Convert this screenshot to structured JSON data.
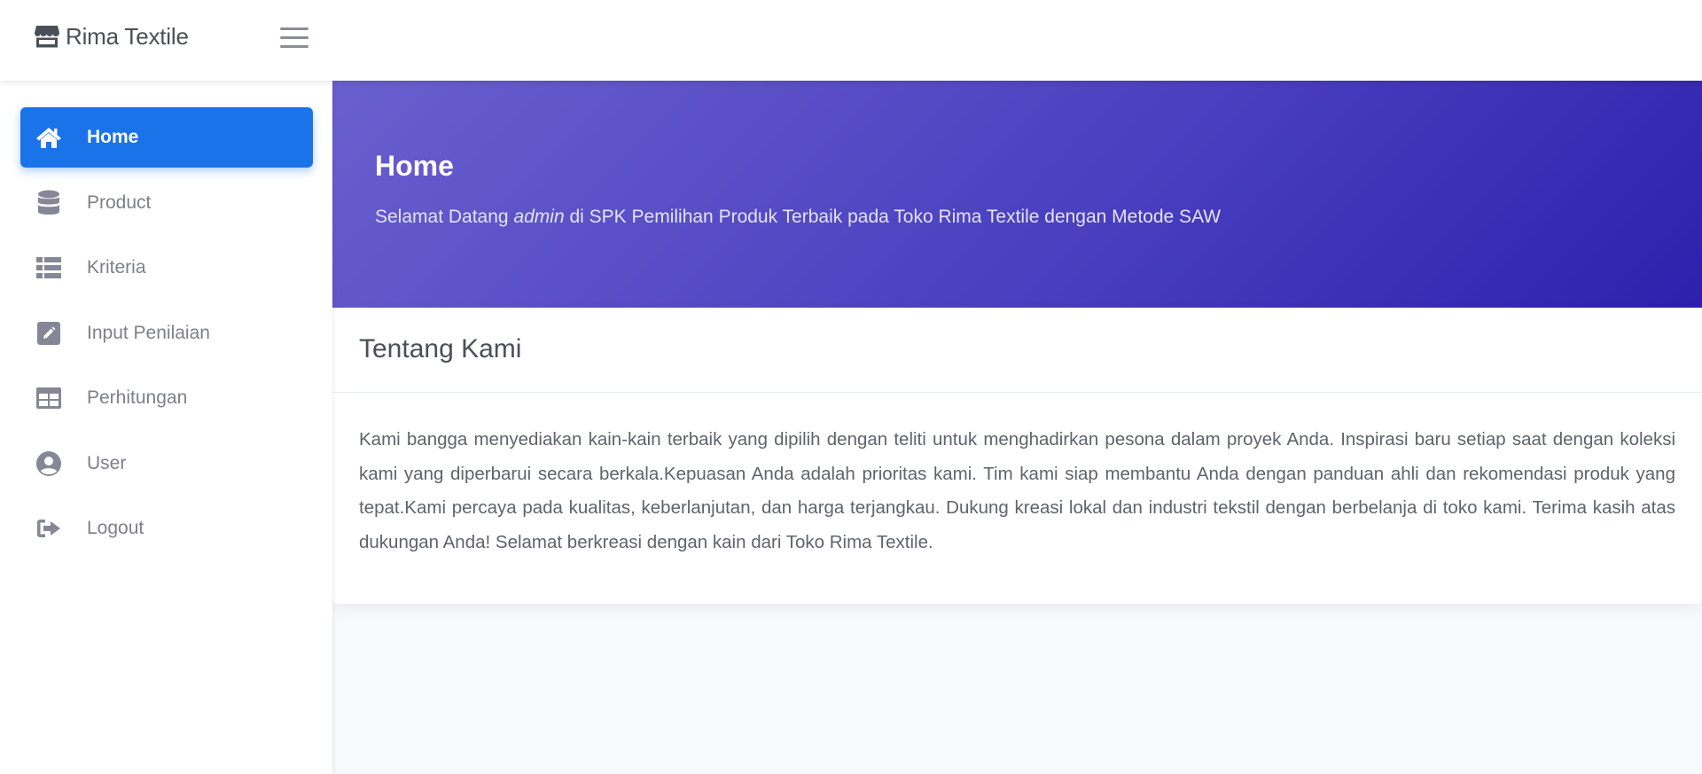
{
  "brand": {
    "name": "Rima Textile",
    "icon": "store-icon"
  },
  "topbar": {
    "menu_icon": "hamburger-menu-icon"
  },
  "sidebar": {
    "items": [
      {
        "label": "Home",
        "icon": "home-icon",
        "active": true
      },
      {
        "label": "Product",
        "icon": "database-icon"
      },
      {
        "label": "Kriteria",
        "icon": "list-icon"
      },
      {
        "label": "Input Penilaian",
        "icon": "edit-icon"
      },
      {
        "label": "Perhitungan",
        "icon": "table-icon"
      },
      {
        "label": "User",
        "icon": "user-circle-icon"
      },
      {
        "label": "Logout",
        "icon": "sign-out-icon"
      }
    ]
  },
  "hero": {
    "title": "Home",
    "welcome_prefix": "Selamat Datang",
    "username": "admin",
    "welcome_suffix": "di SPK Pemilihan Produk Terbaik pada Toko Rima Textile dengan Metode SAW"
  },
  "about": {
    "title": "Tentang Kami",
    "body": "Kami bangga menyediakan kain-kain terbaik yang dipilih dengan teliti untuk menghadirkan pesona dalam proyek Anda. Inspirasi baru setiap saat dengan koleksi kami yang diperbarui secara berkala.Kepuasan Anda adalah prioritas kami. Tim kami siap membantu Anda dengan panduan ahli dan rekomendasi produk yang tepat.Kami percaya pada kualitas, keberlanjutan, dan harga terjangkau. Dukung kreasi lokal dan industri tekstil dengan berbelanja di toko kami. Terima kasih atas dukungan Anda! Selamat berkreasi dengan kain dari Toko Rima Textile."
  },
  "colors": {
    "primary": "#1a73e8",
    "hero_start": "#6a5fce",
    "hero_end": "#2d20ac",
    "background": "#f8f9fc"
  }
}
